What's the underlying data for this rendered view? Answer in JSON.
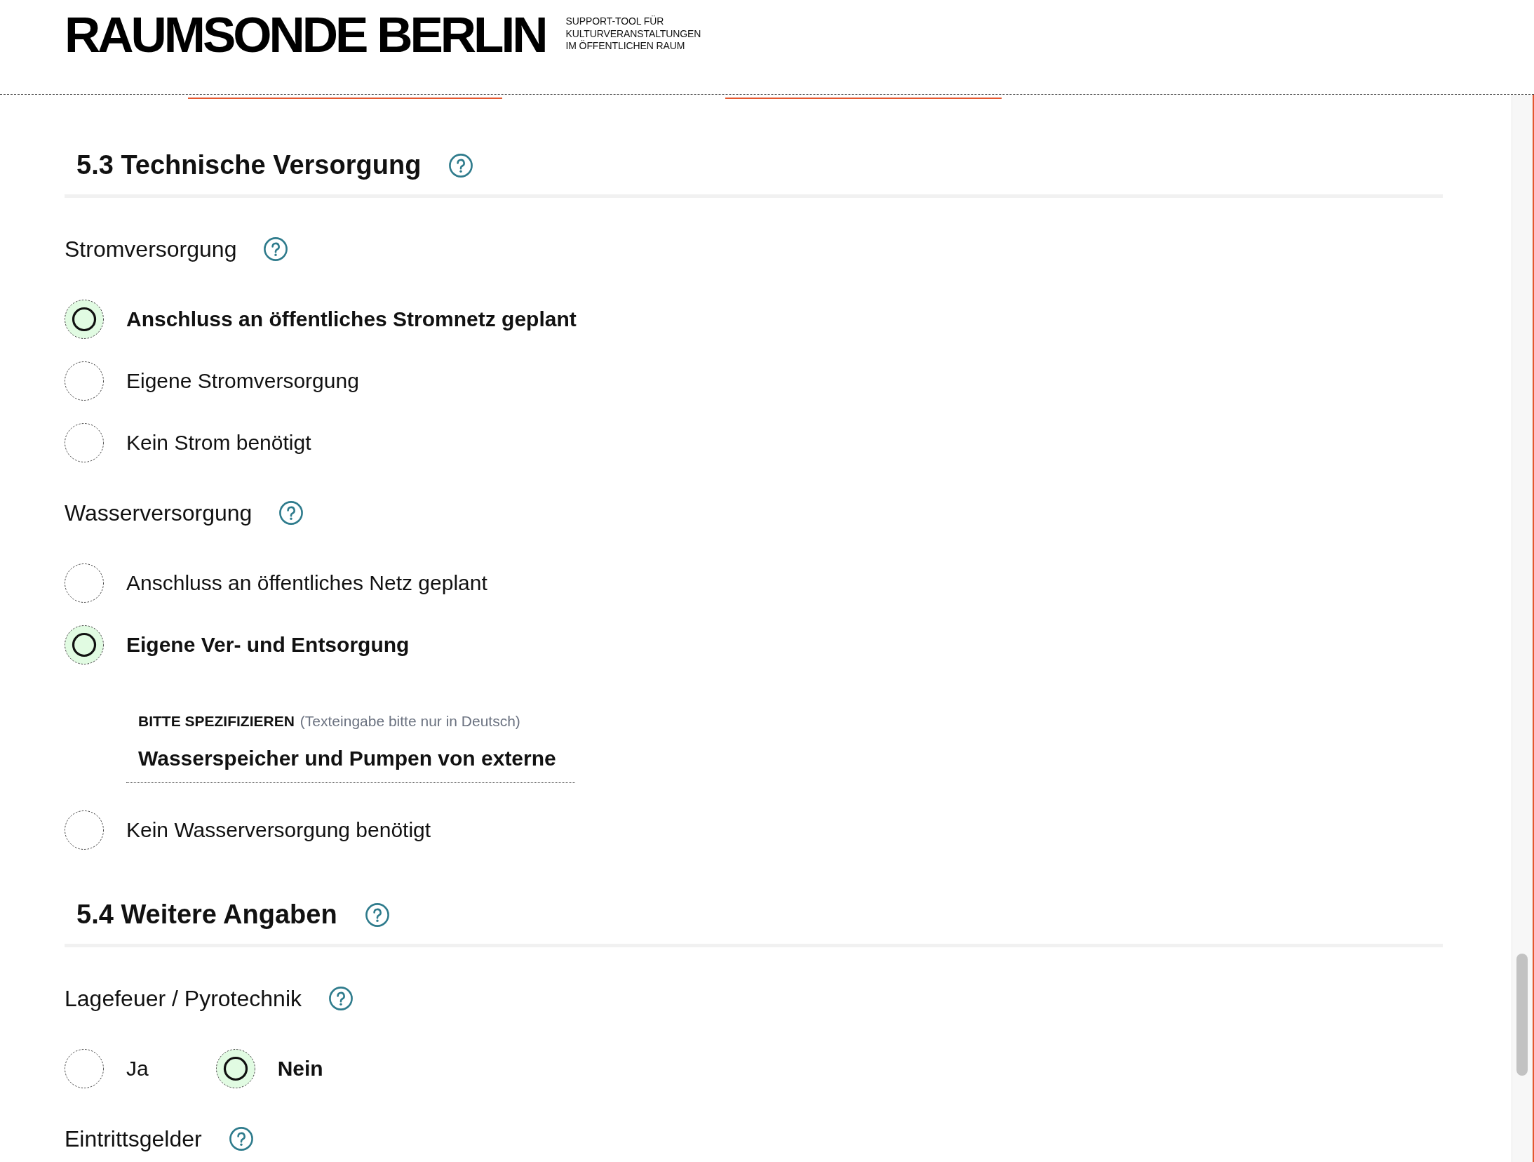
{
  "header": {
    "logo": "RAUMSONDE BERLIN",
    "tagline": [
      "SUPPORT-TOOL FÜR",
      "KULTURVERANSTALTUNGEN",
      "IM ÖFFENTLICHEN RAUM"
    ]
  },
  "sections": [
    {
      "title": "5.3 Technische Versorgung",
      "fields": [
        {
          "label": "Stromversorgung",
          "inline": false,
          "options": [
            {
              "label": "Anschluss an öffentliches Stromnetz geplant",
              "selected": true
            },
            {
              "label": "Eigene Stromversorgung",
              "selected": false
            },
            {
              "label": "Kein Strom benötigt",
              "selected": false
            }
          ]
        },
        {
          "label": "Wasserversorgung",
          "inline": false,
          "options": [
            {
              "label": "Anschluss an öffentliches Netz geplant",
              "selected": false
            },
            {
              "label": "Eigene Ver- und Entsorgung",
              "selected": true,
              "specify": {
                "label": "BITTE SPEZIFIZIEREN",
                "hint": "(Texteingabe bitte nur in Deutsch)",
                "value": "Wasserspeicher und Pumpen von externe"
              }
            },
            {
              "label": "Kein Wasserversorgung benötigt",
              "selected": false
            }
          ]
        }
      ]
    },
    {
      "title": "5.4 Weitere Angaben",
      "fields": [
        {
          "label": "Lagefeuer / Pyrotechnik",
          "inline": true,
          "options": [
            {
              "label": "Ja",
              "selected": false
            },
            {
              "label": "Nein",
              "selected": true
            }
          ]
        },
        {
          "label": "Eintrittsgelder"
        }
      ]
    }
  ]
}
